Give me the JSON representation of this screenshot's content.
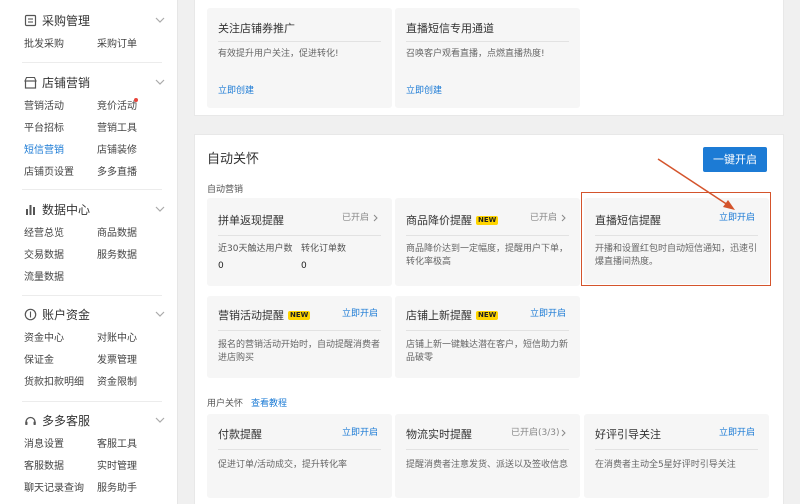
{
  "sidebar": {
    "sections": [
      {
        "title": "采购管理",
        "icon": "doc-list-icon",
        "items": [
          "批发采购",
          "采购订单"
        ]
      },
      {
        "title": "店铺营销",
        "icon": "store-icon",
        "items": [
          "营销活动",
          "竞价活动",
          "平台招标",
          "营销工具",
          "短信营销",
          "店铺装修",
          "店铺页设置",
          "多多直播"
        ]
      },
      {
        "title": "数据中心",
        "icon": "bar-chart-icon",
        "items": [
          "经营总览",
          "商品数据",
          "交易数据",
          "服务数据",
          "流量数据"
        ]
      },
      {
        "title": "账户资金",
        "icon": "wallet-icon",
        "items": [
          "资金中心",
          "对账中心",
          "保证金",
          "发票管理",
          "货款扣款明细",
          "资金限制"
        ]
      },
      {
        "title": "多多客服",
        "icon": "headset-icon",
        "items": [
          "消息设置",
          "客服工具",
          "客服数据",
          "实时管理",
          "聊天记录查询",
          "服务助手"
        ]
      }
    ]
  },
  "top_cards": [
    {
      "title": "关注店铺券推广",
      "desc": "有效提升用户关注，促进转化!",
      "link": "立即创建"
    },
    {
      "title": "直播短信专用通道",
      "desc": "召唤客户观看直播，点燃直播热度!",
      "link": "立即创建"
    }
  ],
  "auto_care": {
    "title": "自动关怀",
    "button": "一键开启",
    "auto_marketing_label": "自动营销",
    "user_care_label": "用户关怀",
    "tutorial_link": "查看教程"
  },
  "cards": {
    "pinduan": {
      "title": "拼单返现提醒",
      "status": "已开启",
      "stat1_label": "近30天触达用户数",
      "stat1_value": "0",
      "stat2_label": "转化订单数",
      "stat2_value": "0"
    },
    "price_drop": {
      "title": "商品降价提醒",
      "badge": "NEW",
      "status": "已开启",
      "desc": "商品降价达到一定幅度，提醒用户下单，转化率极高"
    },
    "live_sms": {
      "title": "直播短信提醒",
      "link": "立即开启",
      "desc": "开播和设置红包时自动短信通知，迅速引爆直播间热度。"
    },
    "activity": {
      "title": "营销活动提醒",
      "badge": "NEW",
      "link": "立即开启",
      "desc": "报名的营销活动开始时，自动提醒消费者进店购买"
    },
    "new_item": {
      "title": "店铺上新提醒",
      "badge": "NEW",
      "link": "立即开启",
      "desc": "店铺上新一键触达潜在客户，短信助力新品破零"
    },
    "payment": {
      "title": "付款提醒",
      "link": "立即开启",
      "desc": "促进订单/活动成交，提升转化率"
    },
    "logistics": {
      "title": "物流实时提醒",
      "status": "已开启(3/3)",
      "desc": "提醒消费者注意发货、派送以及签收信息"
    },
    "review": {
      "title": "好评引导关注",
      "link": "立即开启",
      "desc": "在消费者主动全5星好评时引导关注"
    }
  },
  "colors": {
    "accent": "#1c7bd5",
    "highlight": "#d4542c",
    "badge": "#ffd500"
  }
}
